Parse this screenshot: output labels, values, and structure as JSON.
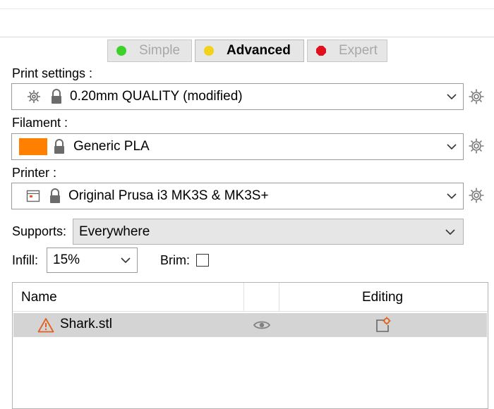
{
  "modes": {
    "simple": {
      "label": "Simple",
      "color": "#3cd22a"
    },
    "advanced": {
      "label": "Advanced",
      "color": "#f3d21a"
    },
    "expert": {
      "label": "Expert",
      "color": "#e0101c"
    }
  },
  "print_settings": {
    "label": "Print settings :",
    "value": "0.20mm QUALITY (modified)",
    "icons": [
      "cog-icon",
      "lock-icon",
      "chevron-down-icon",
      "settings-gear-icon"
    ]
  },
  "filament": {
    "label": "Filament :",
    "value": "Generic PLA",
    "swatch_color": "#ff8000",
    "icons": [
      "color-swatch",
      "lock-icon",
      "chevron-down-icon",
      "settings-gear-icon"
    ]
  },
  "printer": {
    "label": "Printer :",
    "value": "Original Prusa i3 MK3S & MK3S+",
    "icons": [
      "printer-icon",
      "lock-icon",
      "chevron-down-icon",
      "settings-gear-icon"
    ]
  },
  "supports": {
    "label": "Supports:",
    "value": "Everywhere"
  },
  "infill": {
    "label": "Infill:",
    "value": "15%"
  },
  "brim": {
    "label": "Brim:",
    "checked": false
  },
  "object_list": {
    "columns": [
      "Name",
      "",
      "Editing"
    ],
    "rows": [
      {
        "name": "Shark.stl",
        "warning": true,
        "visible": true
      }
    ]
  }
}
